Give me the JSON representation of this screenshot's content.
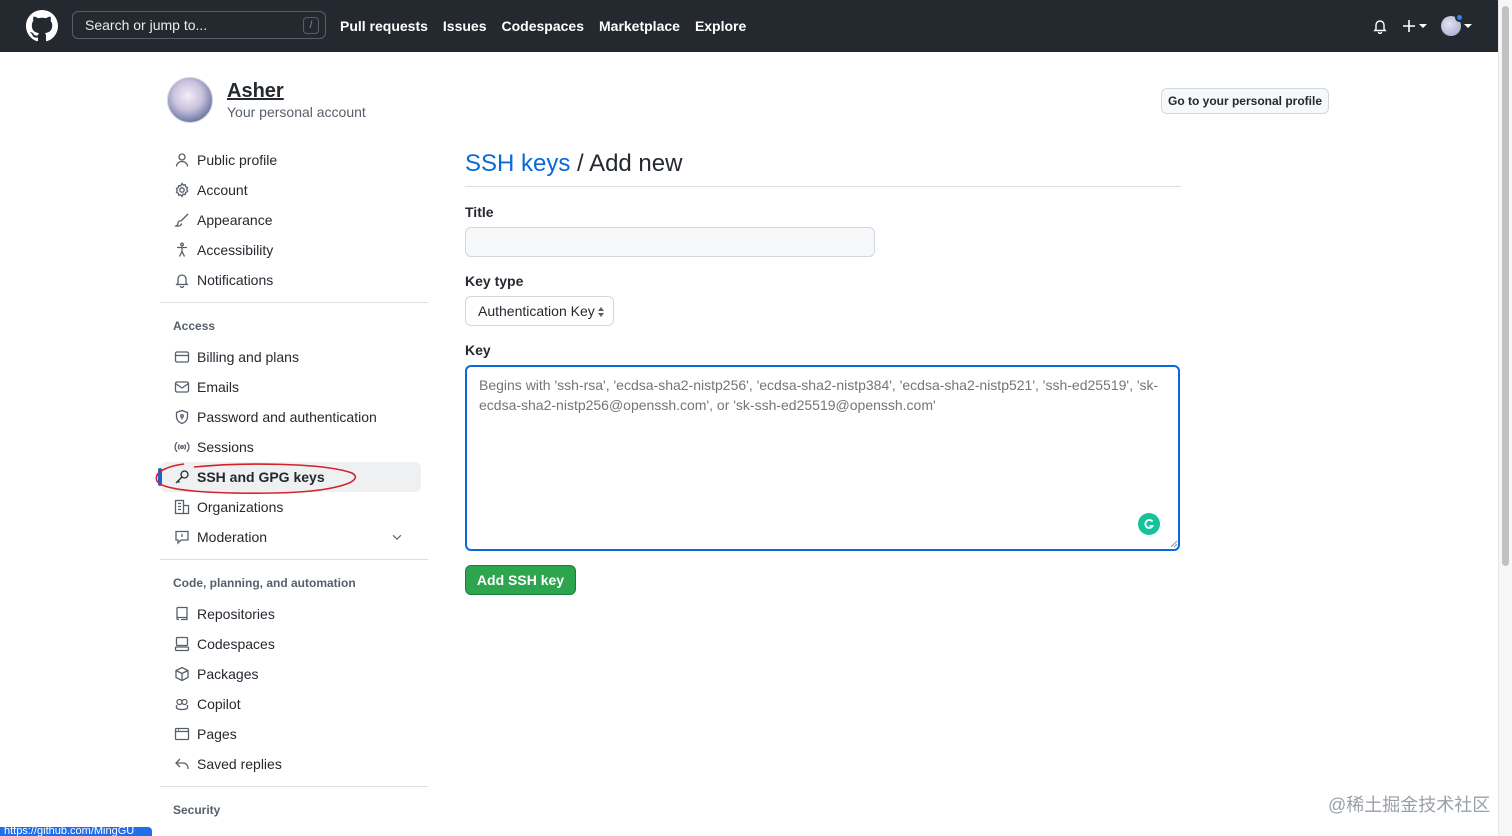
{
  "header": {
    "search_placeholder": "Search or jump to...",
    "search_shortcut": "/",
    "nav": [
      "Pull requests",
      "Issues",
      "Codespaces",
      "Marketplace",
      "Explore"
    ],
    "plus_label": "+"
  },
  "account": {
    "name": "Asher",
    "subtitle": "Your personal account",
    "profile_button": "Go to your personal profile"
  },
  "sidebar": {
    "items_top": [
      {
        "label": "Public profile",
        "icon": "person-icon"
      },
      {
        "label": "Account",
        "icon": "gear-icon"
      },
      {
        "label": "Appearance",
        "icon": "paintbrush-icon"
      },
      {
        "label": "Accessibility",
        "icon": "accessibility-icon"
      },
      {
        "label": "Notifications",
        "icon": "bell-icon"
      }
    ],
    "access_heading": "Access",
    "items_access": [
      {
        "label": "Billing and plans",
        "icon": "credit-card-icon"
      },
      {
        "label": "Emails",
        "icon": "mail-icon"
      },
      {
        "label": "Password and authentication",
        "icon": "shield-lock-icon"
      },
      {
        "label": "Sessions",
        "icon": "broadcast-icon"
      },
      {
        "label": "SSH and GPG keys",
        "icon": "key-icon",
        "active": true
      },
      {
        "label": "Organizations",
        "icon": "organization-icon"
      },
      {
        "label": "Moderation",
        "icon": "comment-icon"
      }
    ],
    "code_heading": "Code, planning, and automation",
    "items_code": [
      {
        "label": "Repositories",
        "icon": "repo-icon"
      },
      {
        "label": "Codespaces",
        "icon": "codespaces-icon"
      },
      {
        "label": "Packages",
        "icon": "package-icon"
      },
      {
        "label": "Copilot",
        "icon": "copilot-icon"
      },
      {
        "label": "Pages",
        "icon": "browser-icon"
      },
      {
        "label": "Saved replies",
        "icon": "reply-icon"
      }
    ],
    "security_heading": "Security"
  },
  "main": {
    "breadcrumb_link": "SSH keys",
    "breadcrumb_sep": " / ",
    "breadcrumb_current": "Add new",
    "title_label": "Title",
    "title_value": "",
    "key_type_label": "Key type",
    "key_type_value": "Authentication Key",
    "key_label": "Key",
    "key_placeholder": "Begins with 'ssh-rsa', 'ecdsa-sha2-nistp256', 'ecdsa-sha2-nistp384', 'ecdsa-sha2-nistp521', 'ssh-ed25519', 'sk-ecdsa-sha2-nistp256@openssh.com', or 'sk-ssh-ed25519@openssh.com'",
    "submit_label": "Add SSH key"
  },
  "status_url": "https://github.com/MingGU",
  "watermark": "@稀土掘金技术社区",
  "colors": {
    "header_bg": "#24292f",
    "link_blue": "#0969da",
    "button_green": "#2da44e",
    "annotation_red": "#d1242f"
  }
}
